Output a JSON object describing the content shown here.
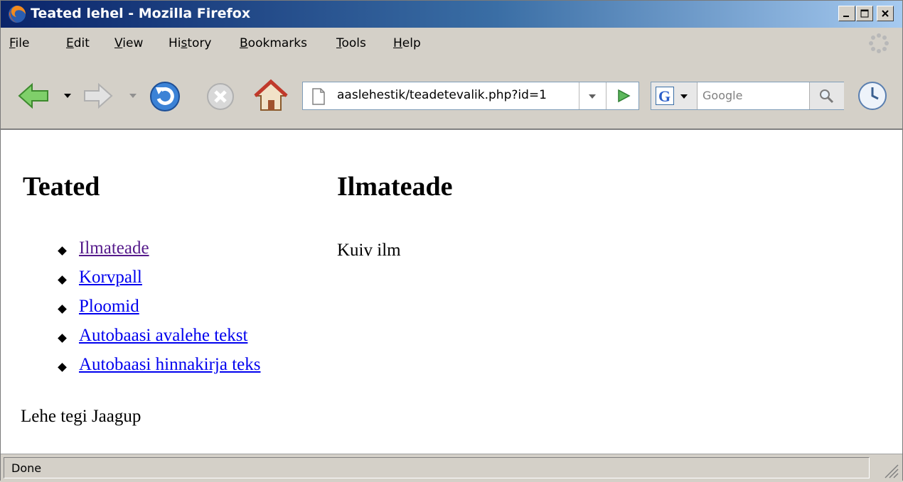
{
  "window": {
    "title": "Teated lehel - Mozilla Firefox"
  },
  "menu": {
    "file": "ile",
    "file_u": "F",
    "edit": "dit",
    "edit_u": "E",
    "view": "iew",
    "view_u": "V",
    "history_a": "Hi",
    "history_u": "s",
    "history_b": "tory",
    "bookmarks": "ookmarks",
    "bookmarks_u": "B",
    "tools": "ools",
    "tools_u": "T",
    "help": "elp",
    "help_u": "H"
  },
  "toolbar": {
    "url": "aaslehestik/teadetevalik.php?id=1",
    "search_placeholder": "Google"
  },
  "page": {
    "sidebar_heading": "Teated",
    "main_heading": "Ilmateade",
    "links": [
      "Ilmateade",
      "Korvpall",
      "Ploomid",
      "Autobaasi avalehe tekst",
      "Autobaasi hinnakirja teks"
    ],
    "body": "Kuiv ilm",
    "footer": "Lehe tegi Jaagup"
  },
  "status": {
    "text": "Done"
  },
  "icons": [
    "firefox-icon",
    "back-icon",
    "forward-icon",
    "reload-icon",
    "stop-icon",
    "home-icon",
    "page-icon",
    "go-icon",
    "google-icon",
    "search-icon",
    "history-clock-icon",
    "throbber-icon"
  ]
}
